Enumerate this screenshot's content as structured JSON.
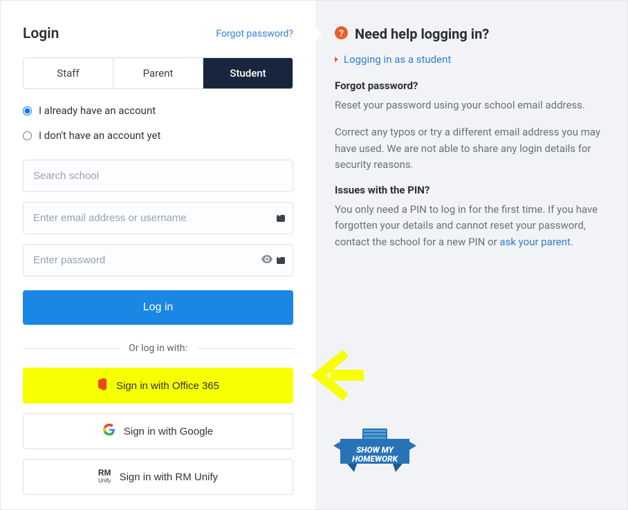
{
  "login": {
    "title": "Login",
    "forgot_link": "Forgot password?",
    "tabs": {
      "staff": "Staff",
      "parent": "Parent",
      "student": "Student"
    },
    "radio_have": "I already have an account",
    "radio_nohave": "I don't have an account yet",
    "search_placeholder": "Search school",
    "email_placeholder": "Enter email address or username",
    "password_placeholder": "Enter password",
    "login_btn": "Log in",
    "divider": "Or log in with:",
    "sso": {
      "office365": "Sign in with Office 365",
      "google": "Sign in with Google",
      "rmunify": "Sign in with RM Unify"
    }
  },
  "help": {
    "title": "Need help logging in?",
    "link_student": "Logging in as a student",
    "forgot_heading": "Forgot password?",
    "forgot_p1": "Reset your password using your school email address.",
    "forgot_p2": "Correct any typos or try a different email address you may have used. We are not able to share any login details for security reasons.",
    "pin_heading": "Issues with the PIN?",
    "pin_p_prefix": "You only need a PIN to log in for the first time. If you have forgotten your details and cannot reset your password, contact the school for a new PIN or ",
    "pin_link": "ask your parent",
    "pin_suffix": "."
  },
  "logo": {
    "line1": "SHOW MY",
    "line2": "HOMEWORK"
  }
}
